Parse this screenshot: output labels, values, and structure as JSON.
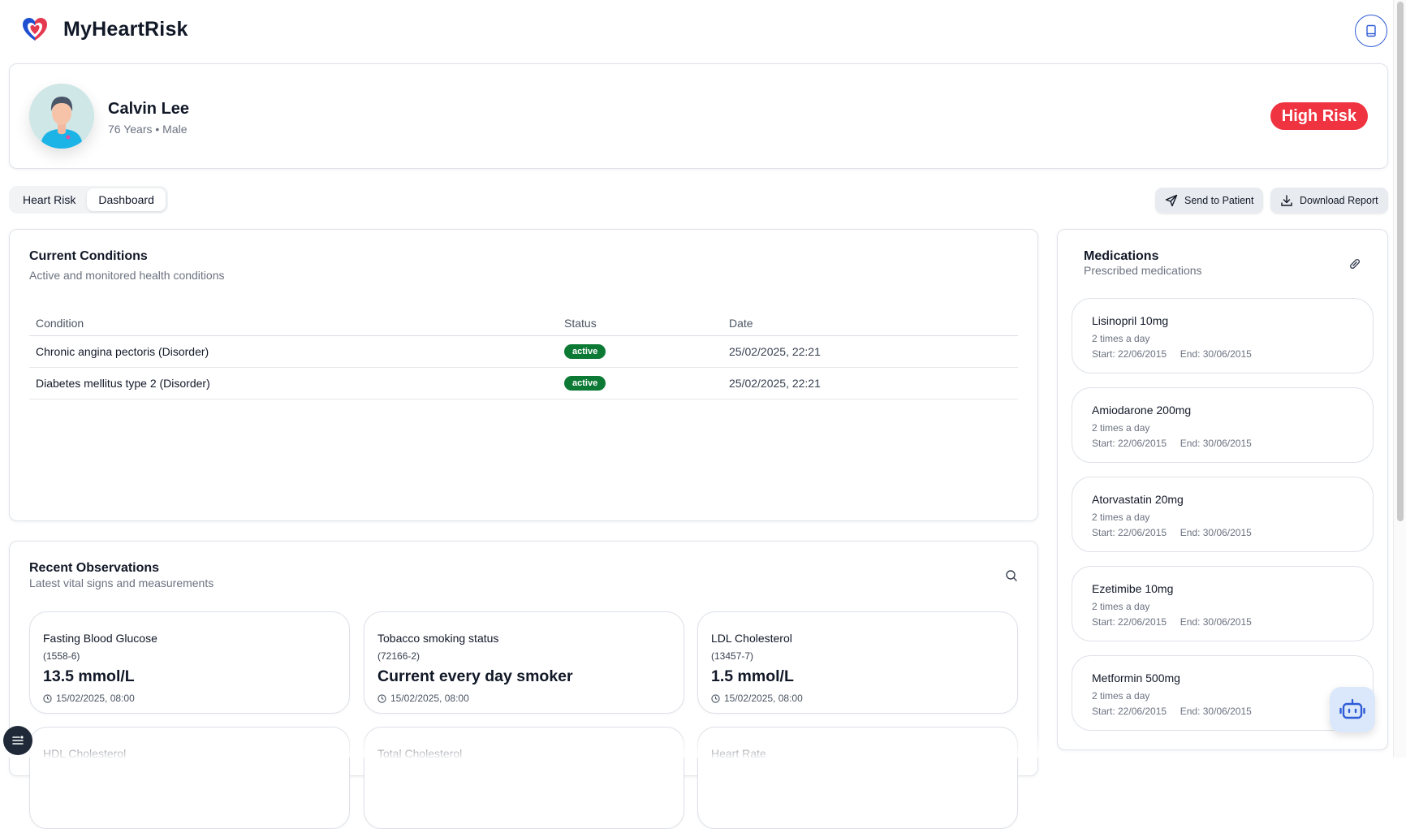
{
  "app": {
    "title": "MyHeartRisk",
    "top_icon": "book-icon"
  },
  "patient": {
    "name": "Calvin Lee",
    "meta": "76 Years • Male",
    "risk_label": "High Risk",
    "risk_color": "#ef3340"
  },
  "tabs": [
    {
      "label": "Heart Risk",
      "active": false
    },
    {
      "label": "Dashboard",
      "active": true
    }
  ],
  "actions": {
    "send_label": "Send to Patient",
    "download_label": "Download Report"
  },
  "conditions": {
    "title": "Current Conditions",
    "subtitle": "Active and monitored health conditions",
    "columns": [
      "Condition",
      "Status",
      "Date"
    ],
    "rows": [
      {
        "condition": "Chronic angina pectoris (Disorder)",
        "status": "active",
        "date": "25/02/2025, 22:21"
      },
      {
        "condition": "Diabetes mellitus type 2 (Disorder)",
        "status": "active",
        "date": "25/02/2025, 22:21"
      }
    ]
  },
  "observations": {
    "title": "Recent Observations",
    "subtitle": "Latest vital signs and measurements",
    "items": [
      {
        "name": "Fasting Blood Glucose",
        "code": "(1558-6)",
        "value": "13.5 mmol/L",
        "time": "15/02/2025, 08:00"
      },
      {
        "name": "Tobacco smoking status",
        "code": "(72166-2)",
        "value": "Current every day smoker",
        "time": "15/02/2025, 08:00"
      },
      {
        "name": "LDL Cholesterol",
        "code": "(13457-7)",
        "value": "1.5 mmol/L",
        "time": "15/02/2025, 08:00"
      },
      {
        "name": "HDL Cholesterol",
        "code": "",
        "value": "",
        "time": ""
      },
      {
        "name": "Total Cholesterol",
        "code": "",
        "value": "",
        "time": ""
      },
      {
        "name": "Heart Rate",
        "code": "",
        "value": "",
        "time": ""
      }
    ]
  },
  "medications": {
    "title": "Medications",
    "subtitle": "Prescribed medications",
    "items": [
      {
        "name": "Lisinopril 10mg",
        "frequency": "2 times a day",
        "dates": "Start: 22/06/2015     End: 30/06/2015"
      },
      {
        "name": "Amiodarone 200mg",
        "frequency": "2 times a day",
        "dates": "Start: 22/06/2015     End: 30/06/2015"
      },
      {
        "name": "Atorvastatin 20mg",
        "frequency": "2 times a day",
        "dates": "Start: 22/06/2015     End: 30/06/2015"
      },
      {
        "name": "Ezetimibe 10mg",
        "frequency": "2 times a day",
        "dates": "Start: 22/06/2015     End: 30/06/2015"
      },
      {
        "name": "Metformin 500mg",
        "frequency": "2 times a day",
        "dates": "Start: 22/06/2015     End: 30/06/2015"
      }
    ]
  },
  "colors": {
    "accent": "#2f5bd7",
    "status_active": "#0c7a34",
    "risk": "#ef3340"
  }
}
